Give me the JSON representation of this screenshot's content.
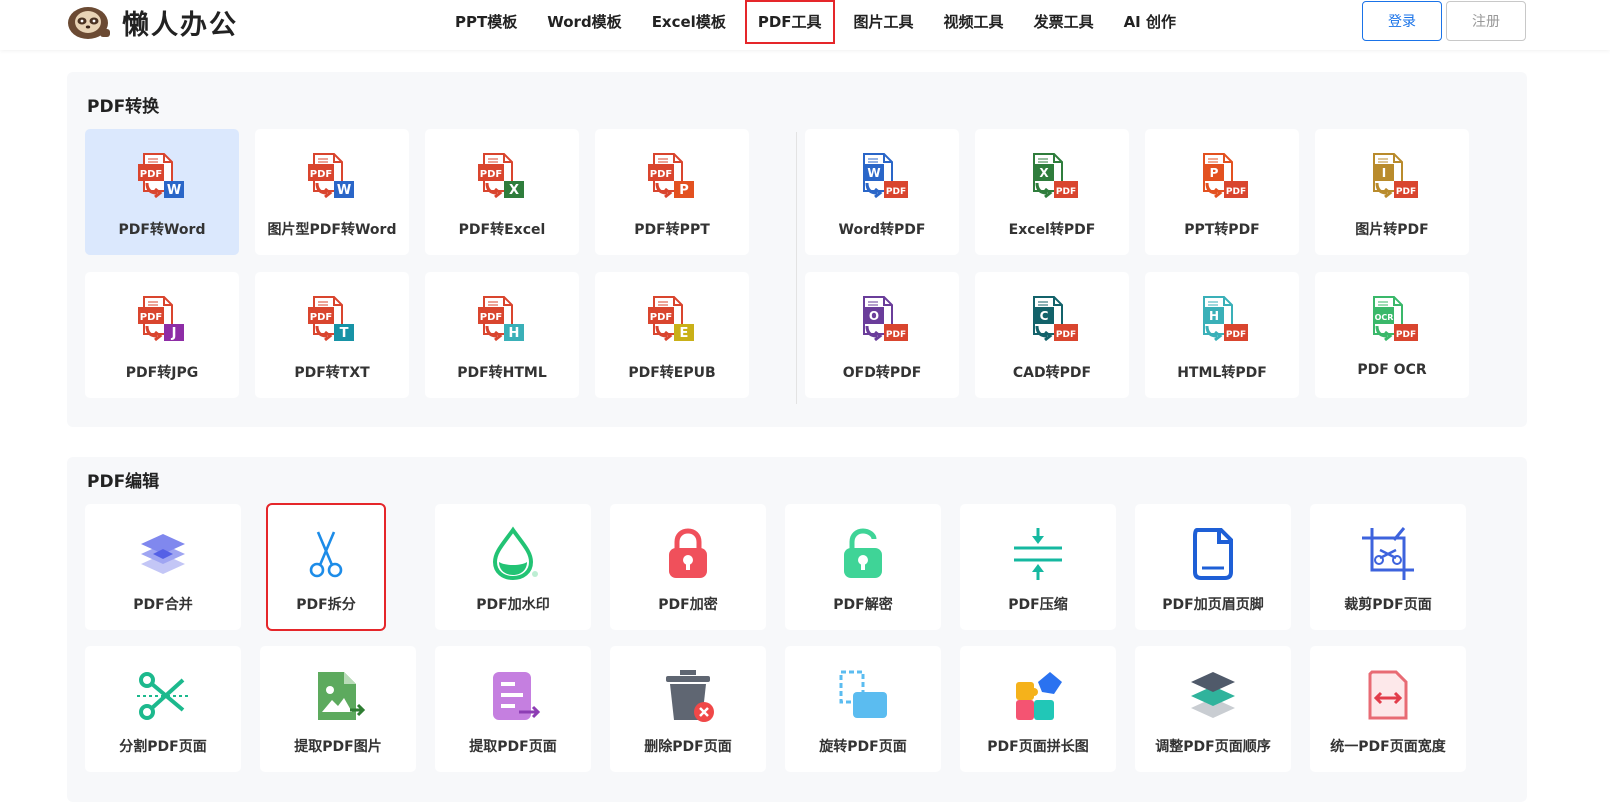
{
  "header": {
    "logo_text": "懒人办公",
    "nav": [
      "PPT模板",
      "Word模板",
      "Excel模板",
      "PDF工具",
      "图片工具",
      "视频工具",
      "发票工具",
      "AI 创作"
    ],
    "active_nav": "PDF工具",
    "login_label": "登录",
    "register_label": "注册"
  },
  "conversion": {
    "title": "PDF转换",
    "pdf_badge": "PDF",
    "left_items": [
      {
        "label": "PDF转Word",
        "letter": "W",
        "color": "#2a66c8"
      },
      {
        "label": "图片型PDF转Word",
        "letter": "W",
        "color": "#2a66c8"
      },
      {
        "label": "PDF转Excel",
        "letter": "X",
        "color": "#2f7d3c"
      },
      {
        "label": "PDF转PPT",
        "letter": "P",
        "color": "#e35120"
      },
      {
        "label": "PDF转JPG",
        "letter": "J",
        "color": "#8e2da6"
      },
      {
        "label": "PDF转TXT",
        "letter": "T",
        "color": "#1793a6"
      },
      {
        "label": "PDF转HTML",
        "letter": "H",
        "color": "#3ab0b8"
      },
      {
        "label": "PDF转EPUB",
        "letter": "E",
        "color": "#c9b018"
      }
    ],
    "right_items": [
      {
        "label": "Word转PDF",
        "letter": "W",
        "color": "#2a66c8"
      },
      {
        "label": "Excel转PDF",
        "letter": "X",
        "color": "#2f7d3c"
      },
      {
        "label": "PPT转PDF",
        "letter": "P",
        "color": "#e35120"
      },
      {
        "label": "图片转PDF",
        "letter": "I",
        "color": "#b98b2c"
      },
      {
        "label": "OFD转PDF",
        "letter": "O",
        "color": "#6a3d9a"
      },
      {
        "label": "CAD转PDF",
        "letter": "C",
        "color": "#13626a"
      },
      {
        "label": "HTML转PDF",
        "letter": "H",
        "color": "#3ab0b8"
      },
      {
        "label": "PDF OCR",
        "letter": "OCR",
        "color": "#3ab86a"
      }
    ]
  },
  "editing": {
    "title": "PDF编辑",
    "items": [
      {
        "label": "PDF合并",
        "icon": "layers-icon"
      },
      {
        "label": "PDF拆分",
        "icon": "scissors-icon"
      },
      {
        "label": "PDF加水印",
        "icon": "water-drop-icon"
      },
      {
        "label": "PDF加密",
        "icon": "lock-icon"
      },
      {
        "label": "PDF解密",
        "icon": "unlock-icon"
      },
      {
        "label": "PDF压缩",
        "icon": "compress-icon"
      },
      {
        "label": "PDF加页眉页脚",
        "icon": "page-header-icon"
      },
      {
        "label": "裁剪PDF页面",
        "icon": "crop-icon"
      },
      {
        "label": "分割PDF页面",
        "icon": "split-scissors-icon"
      },
      {
        "label": "提取PDF图片",
        "icon": "image-extract-icon"
      },
      {
        "label": "提取PDF页面",
        "icon": "page-extract-icon"
      },
      {
        "label": "删除PDF页面",
        "icon": "trash-icon"
      },
      {
        "label": "旋转PDF页面",
        "icon": "rotate-page-icon"
      },
      {
        "label": "PDF页面拼长图",
        "icon": "puzzle-icon"
      },
      {
        "label": "调整PDF页面顺序",
        "icon": "reorder-layers-icon"
      },
      {
        "label": "统一PDF页面宽度",
        "icon": "width-arrows-icon"
      }
    ]
  }
}
